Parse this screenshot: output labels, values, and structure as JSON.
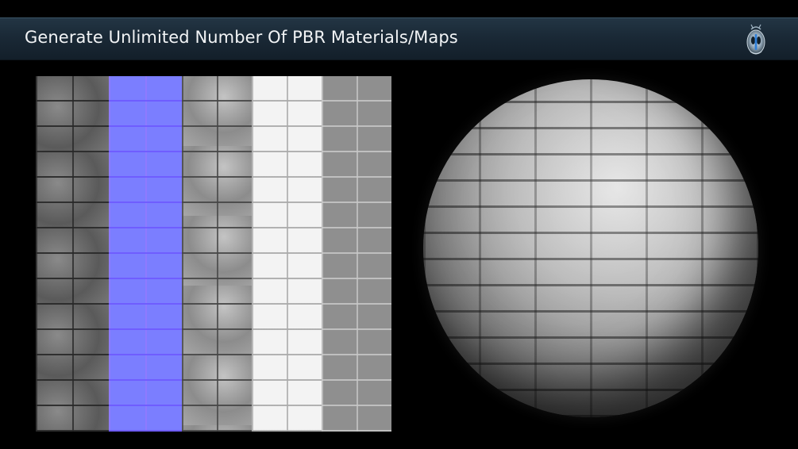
{
  "banner": {
    "title": "Generate Unlimited Number Of PBR Materials/Maps",
    "logo_icon": "alien-pod-logo-icon"
  },
  "preview": {
    "map_strips": [
      {
        "kind": "base-color",
        "color": "#6e6e6e"
      },
      {
        "kind": "normal",
        "color": "#7b7eff"
      },
      {
        "kind": "height",
        "color": "#9a9a9a"
      },
      {
        "kind": "ambient-occlusion",
        "color": "#f3f3f3"
      },
      {
        "kind": "roughness",
        "color": "#8f8f8f"
      }
    ],
    "sphere_material": "stone-brick"
  },
  "colors": {
    "background": "#000000",
    "banner": "#1a2936",
    "title_text": "#f2f4f6"
  }
}
